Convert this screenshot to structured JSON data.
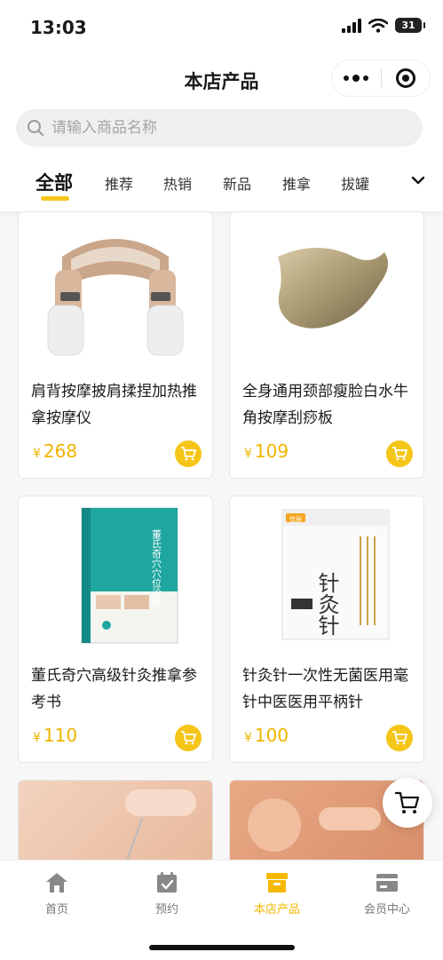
{
  "status_bar": {
    "time": "13:03",
    "battery": "31"
  },
  "nav": {
    "title": "本店产品"
  },
  "search": {
    "placeholder": "请输入商品名称"
  },
  "tabs": [
    {
      "label": "全部",
      "active": true
    },
    {
      "label": "推荐"
    },
    {
      "label": "热销"
    },
    {
      "label": "新品"
    },
    {
      "label": "推拿"
    },
    {
      "label": "拔罐"
    }
  ],
  "products": [
    {
      "title": "肩背按摩披肩揉捏加热推拿按摩仪",
      "currency": "¥",
      "price": "268",
      "image": "massage-shawl"
    },
    {
      "title": "全身通用颈部瘦脸白水牛角按摩刮痧板",
      "currency": "¥",
      "price": "109",
      "image": "gua-sha-board"
    },
    {
      "title": "董氏奇穴高级针灸推拿参考书",
      "currency": "¥",
      "price": "110",
      "image": "book-cover"
    },
    {
      "title": "针灸针一次性无菌医用毫针中医医用平柄针",
      "currency": "¥",
      "price": "100",
      "image": "needle-box"
    }
  ],
  "book_cover_text": {
    "title": "董氏奇穴穴位诠解"
  },
  "box_text": {
    "brand": "佳辰",
    "name": "针灸针"
  },
  "tabbar": [
    {
      "label": "首页",
      "icon": "home-icon"
    },
    {
      "label": "预约",
      "icon": "calendar-icon"
    },
    {
      "label": "本店产品",
      "icon": "store-icon",
      "active": true
    },
    {
      "label": "会员中心",
      "icon": "member-card-icon"
    }
  ],
  "colors": {
    "accent": "#f5c518",
    "price": "#f0b400"
  }
}
